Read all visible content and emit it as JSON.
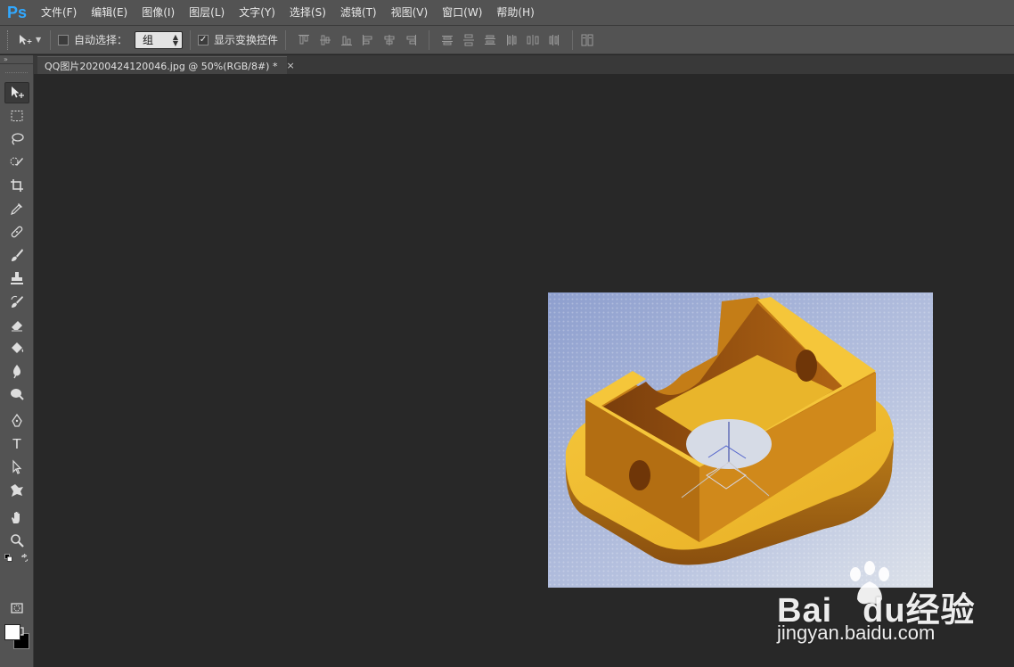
{
  "app": {
    "logo": "Ps"
  },
  "menu": [
    {
      "label": "文件(F)"
    },
    {
      "label": "编辑(E)"
    },
    {
      "label": "图像(I)"
    },
    {
      "label": "图层(L)"
    },
    {
      "label": "文字(Y)"
    },
    {
      "label": "选择(S)"
    },
    {
      "label": "滤镜(T)"
    },
    {
      "label": "视图(V)"
    },
    {
      "label": "窗口(W)"
    },
    {
      "label": "帮助(H)"
    }
  ],
  "options": {
    "auto_select_label": "自动选择：",
    "auto_select_checked": false,
    "select_value": "组",
    "show_transform_label": "显示变换控件",
    "show_transform_checked": true
  },
  "document": {
    "tab_title": "QQ图片20200424120046.jpg @ 50%(RGB/8#) *",
    "close_glyph": "×"
  },
  "toolbar": {
    "collapse_glyph": "»",
    "tools": [
      {
        "name": "move-tool",
        "icon": "move-icon"
      },
      {
        "name": "marquee-tool",
        "icon": "rect-marquee-icon"
      },
      {
        "name": "lasso-tool",
        "icon": "lasso-icon"
      },
      {
        "name": "quick-select-tool",
        "icon": "quick-select-icon"
      },
      {
        "name": "crop-tool",
        "icon": "crop-icon"
      },
      {
        "name": "eyedropper-tool",
        "icon": "eyedropper-icon"
      },
      {
        "name": "healing-tool",
        "icon": "bandage-icon"
      },
      {
        "name": "brush-tool",
        "icon": "brush-icon"
      },
      {
        "name": "stamp-tool",
        "icon": "stamp-icon"
      },
      {
        "name": "history-brush-tool",
        "icon": "history-brush-icon"
      },
      {
        "name": "eraser-tool",
        "icon": "eraser-icon"
      },
      {
        "name": "paint-bucket-tool",
        "icon": "bucket-icon"
      },
      {
        "name": "blur-tool",
        "icon": "blur-icon"
      },
      {
        "name": "dodge-tool",
        "icon": "dodge-icon"
      },
      {
        "name": "pen-tool",
        "icon": "pen-icon"
      },
      {
        "name": "type-tool",
        "icon": "type-icon",
        "glyph": "T"
      },
      {
        "name": "path-select-tool",
        "icon": "path-select-icon"
      },
      {
        "name": "shape-tool",
        "icon": "shape-icon"
      },
      {
        "name": "hand-tool",
        "icon": "hand-icon"
      },
      {
        "name": "zoom-tool",
        "icon": "zoom-icon"
      }
    ]
  },
  "colors": {
    "foreground": "#ffffff",
    "background": "#000000",
    "ps_blue": "#31a8ff"
  },
  "watermark": {
    "text": "Bai",
    "text2": "du",
    "text3": "经验",
    "url": "jingyan.baidu.com"
  }
}
